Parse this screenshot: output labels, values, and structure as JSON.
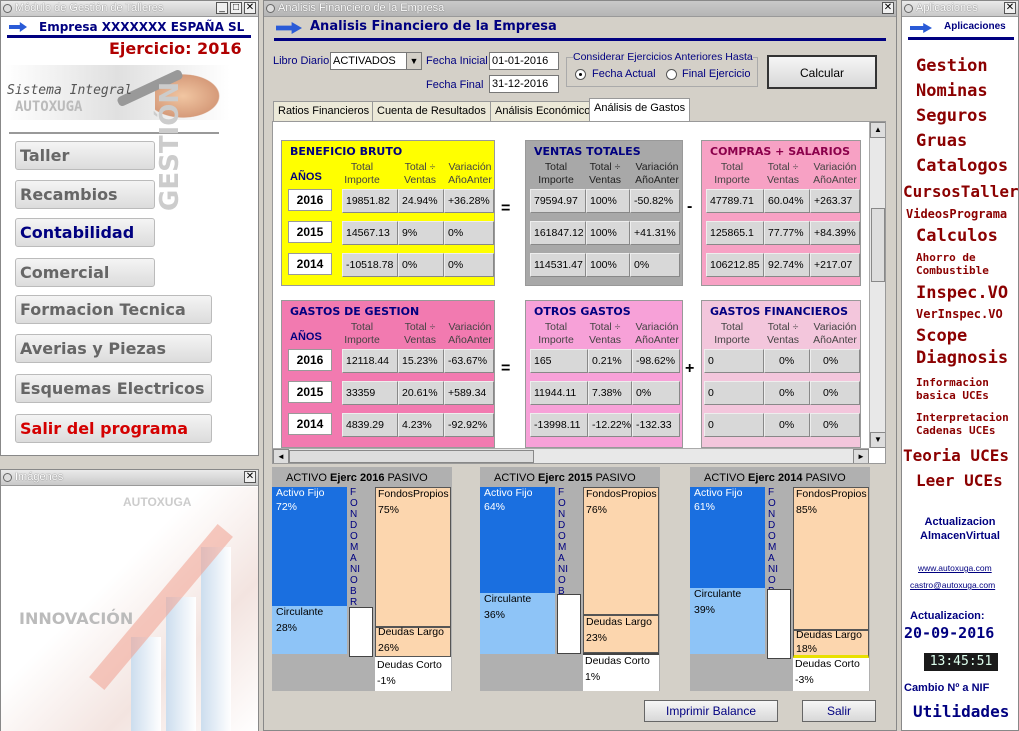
{
  "left_window": {
    "title": "Módulo de Gestión de Talleres",
    "company": "Empresa XXXXXXX ESPAÑA SL",
    "ejercicio": "Ejercicio: 2016",
    "logo_line1": "Sistema Integral",
    "logo_line2": "AUTOXUGA",
    "vertical_label": "GESTIÓN",
    "menu": [
      "Taller",
      "Recambios",
      "Contabilidad",
      "Comercial",
      "Formacion Tecnica",
      "Averias y Piezas",
      "Esquemas Electricos",
      "Salir del programa"
    ]
  },
  "images_window": {
    "title": "Imágenes",
    "brand": "AUTOXUGA",
    "caption": "INNOVACIÓN"
  },
  "main_window": {
    "title": "Analisis Financiero de la Empresa",
    "header": "Analisis Financiero de la Empresa",
    "libro_label": "Libro Diario",
    "libro_value": "ACTIVADOS",
    "fecha_inicial_label": "Fecha Inicial",
    "fecha_inicial": "01-01-2016",
    "fecha_final_label": "Fecha Final",
    "fecha_final": "31-12-2016",
    "group_label": "Considerar Ejercicios Anteriores Hasta",
    "radio1": "Fecha Actual",
    "radio2": "Final Ejercicio",
    "calcular": "Calcular",
    "tabs": [
      "Ratios Financieros",
      "Cuenta de Resultados",
      "Análisis Económico",
      "Análisis de Gastos"
    ],
    "col_headers": {
      "total": "Total Importe",
      "pct": "Total ÷ Ventas",
      "var": "Variación AñoAnter"
    },
    "anos_label": "AÑOS",
    "years": [
      "2016",
      "2015",
      "2014"
    ],
    "equals": "=",
    "minus": "-",
    "plus": "+",
    "panels": {
      "beneficio": {
        "title": "BENEFICIO BRUTO",
        "rows": [
          [
            "19851.82",
            "24.94%",
            "+36.28%"
          ],
          [
            "14567.13",
            "9%",
            "0%"
          ],
          [
            "-10518.78",
            "0%",
            "0%"
          ]
        ]
      },
      "ventas": {
        "title": "VENTAS TOTALES",
        "rows": [
          [
            "79594.97",
            "100%",
            "-50.82%"
          ],
          [
            "161847.12",
            "100%",
            "+41.31%"
          ],
          [
            "114531.47",
            "100%",
            "0%"
          ]
        ]
      },
      "compras": {
        "title": "COMPRAS + SALARIOS",
        "rows": [
          [
            "47789.71",
            "60.04%",
            "+263.37"
          ],
          [
            "125865.1",
            "77.77%",
            "+84.39%"
          ],
          [
            "106212.85",
            "92.74%",
            "+217.07"
          ]
        ]
      },
      "gestion": {
        "title": "GASTOS DE GESTION",
        "rows": [
          [
            "12118.44",
            "15.23%",
            "-63.67%"
          ],
          [
            "33359",
            "20.61%",
            "+589.34"
          ],
          [
            "4839.29",
            "4.23%",
            "-92.92%"
          ]
        ]
      },
      "otros": {
        "title": "OTROS GASTOS",
        "rows": [
          [
            "165",
            "0.21%",
            "-98.62%"
          ],
          [
            "11944.11",
            "7.38%",
            "0%"
          ],
          [
            "-13998.11",
            "-12.22%",
            "-132.33"
          ]
        ]
      },
      "financieros": {
        "title": "GASTOS FINANCIEROS",
        "rows": [
          [
            "0",
            "0%",
            "0%"
          ],
          [
            "0",
            "0%",
            "0%"
          ],
          [
            "0",
            "0%",
            "0%"
          ]
        ]
      }
    },
    "balances": [
      {
        "activo": "ACTIVO",
        "ejerc": "Ejerc 2016",
        "pasivo": "PASIVO",
        "af_label": "Activo Fijo",
        "af": "72%",
        "circ_label": "Circulante",
        "circ": "28%",
        "fm": "FONDO MANIOBRA",
        "fp_label": "FondosPropios",
        "fp": "75%",
        "dl_label": "Deudas Largo",
        "dl": "26%",
        "dc_label": "Deudas Corto",
        "dc": "-1%"
      },
      {
        "activo": "ACTIVO",
        "ejerc": "Ejerc 2015",
        "pasivo": "PASIVO",
        "af_label": "Activo Fijo",
        "af": "64%",
        "circ_label": "Circulante",
        "circ": "36%",
        "fm": "FONDO MANIOBRA",
        "fp_label": "FondosPropios",
        "fp": "76%",
        "dl_label": "Deudas Largo",
        "dl": "23%",
        "dc_label": "Deudas Corto",
        "dc": "1%"
      },
      {
        "activo": "ACTIVO",
        "ejerc": "Ejerc 2014",
        "pasivo": "PASIVO",
        "af_label": "Activo Fijo",
        "af": "61%",
        "circ_label": "Circulante",
        "circ": "39%",
        "fm": "FONDO MANIOBRA",
        "fp_label": "FondosPropios",
        "fp": "85%",
        "dl_label": "Deudas Largo",
        "dl": "18%",
        "dc_label": "Deudas Corto",
        "dc": "-3%"
      }
    ],
    "imprimir": "Imprimir Balance",
    "salir": "Salir"
  },
  "right_window": {
    "title": "Aplicaciones",
    "header": "Aplicaciones",
    "links": [
      "Gestion",
      "Nominas",
      "Seguros",
      "Gruas",
      "Catalogos",
      "CursosTaller",
      "VideosPrograma",
      "Calculos",
      "Ahorro de Combustible",
      "Inspec.VO",
      "VerInspec.VO",
      "Scope",
      "Diagnosis",
      "Informacion basica UCEs",
      "Interpretacion Cadenas UCEs",
      "Teoria UCEs",
      "Leer UCEs"
    ],
    "actualizacion_almacen": "Actualizacion AlmacenVirtual",
    "web": "www.autoxuga.com",
    "email": "castro@autoxuga.com",
    "actualizacion_label": "Actualizacion:",
    "actualizacion_date": "20-09-2016",
    "clock": "13:45:51",
    "cambio": "Cambio Nº a NIF",
    "utilidades": "Utilidades"
  },
  "colors": {
    "yellow": "#ffff00",
    "gray": "#a8a8a8",
    "pink": "#f7a1c4",
    "hotpink": "#f27ab0",
    "lightpink": "#f3c6dc",
    "blue": "#1a6fe0",
    "lightblue": "#8ec4f7",
    "peach": "#fcd6ae"
  }
}
